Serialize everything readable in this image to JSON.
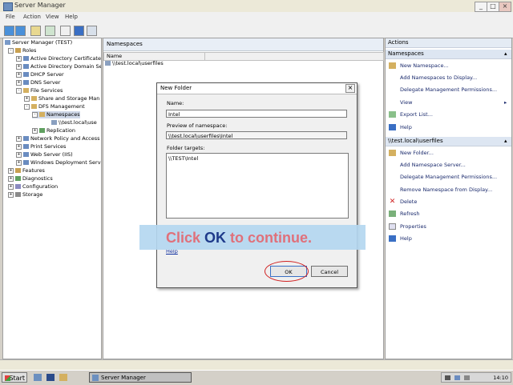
{
  "window": {
    "title": "Server Manager",
    "minimize": "_",
    "maximize": "□",
    "close": "×"
  },
  "menu": [
    "File",
    "Action",
    "View",
    "Help"
  ],
  "tree": {
    "root": "Server Manager (TEST)",
    "roles": "Roles",
    "items": [
      "Active Directory Certificate",
      "Active Directory Domain Se",
      "DHCP Server",
      "DNS Server",
      "File Services",
      "Share and Storage Man",
      "DFS Management",
      "Namespaces",
      "\\\\test.local\\use",
      "Replication",
      "Network Policy and Access",
      "Print Services",
      "Web Server (IIS)",
      "Windows Deployment Servi"
    ],
    "bottom": [
      "Features",
      "Diagnostics",
      "Configuration",
      "Storage"
    ]
  },
  "center": {
    "header": "Namespaces",
    "column1": "Name",
    "row1": "\\\\test.local\\userfiles"
  },
  "actions": {
    "header": "Actions",
    "section1": "Namespaces",
    "section1_items": [
      "New Namespace...",
      "Add Namespaces to Display...",
      "Delegate Management Permissions...",
      "View",
      "Export List...",
      "Help"
    ],
    "section2": "\\\\test.local\\userfiles",
    "section2_items": [
      "New Folder...",
      "Add Namespace Server...",
      "Delegate Management Permissions...",
      "Remove Namespace from Display...",
      "Delete",
      "Refresh",
      "Properties",
      "Help"
    ]
  },
  "dialog": {
    "title": "New Folder",
    "close": "×",
    "name_label": "Name:",
    "name_value": "Intel",
    "preview_label": "Preview of namespace:",
    "preview_value": "\\\\test.local\\userfiles\\Intel",
    "targets_label": "Folder targets:",
    "target1": "\\\\TEST\\Intel",
    "help_link": "Help",
    "ok": "OK",
    "cancel": "Cancel"
  },
  "overlay": {
    "part1": "Click ",
    "part2": "OK",
    "part3": " to continue.",
    "color_main": "#e0707a",
    "color_accent": "#1e3a8a"
  },
  "taskbar": {
    "start": "Start",
    "task": "Server Manager",
    "time": "14:10"
  }
}
